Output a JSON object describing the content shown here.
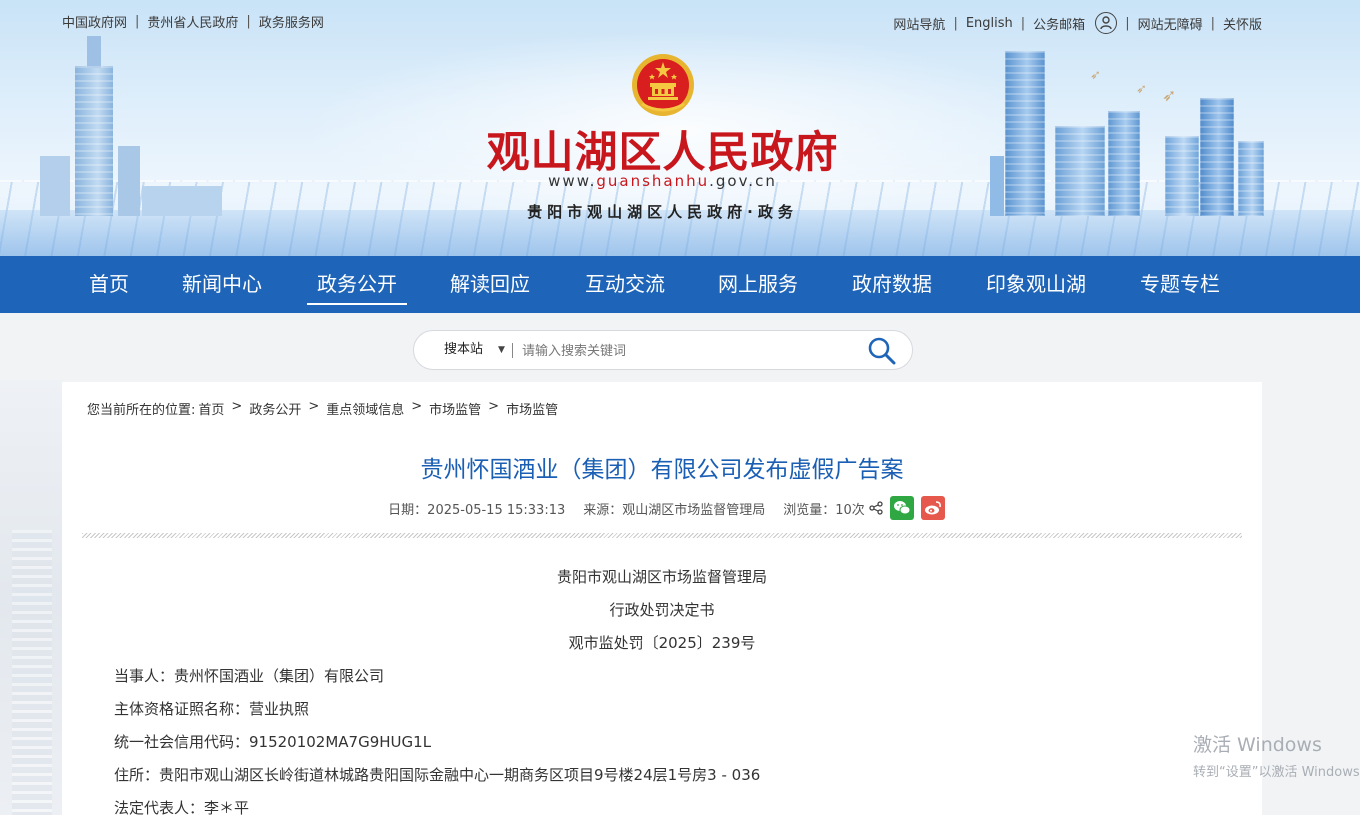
{
  "topbar": {
    "left_links": [
      "中国政府网",
      "贵州省人民政府",
      "政务服务网"
    ],
    "right_links_before_icon": [
      "网站导航",
      "English",
      "公务邮箱"
    ],
    "right_links_after_icon": [
      "网站无障碍",
      "关怀版"
    ]
  },
  "site": {
    "title": "观山湖区人民政府",
    "url_prefix": "www.",
    "url_highlight": "guanshanhu",
    "url_suffix": ".gov.cn",
    "subtitle": "贵阳市观山湖区人民政府·政务"
  },
  "nav": {
    "items": [
      "首页",
      "新闻中心",
      "政务公开",
      "解读回应",
      "互动交流",
      "网上服务",
      "政府数据",
      "印象观山湖",
      "专题专栏"
    ],
    "active": "政务公开"
  },
  "search": {
    "scope": "搜本站",
    "placeholder": "请输入搜索关键词"
  },
  "breadcrumb": {
    "prefix": "您当前所在的位置:",
    "items": [
      "首页",
      "政务公开",
      "重点领域信息",
      "市场监管",
      "市场监管"
    ],
    "separator": ">"
  },
  "article": {
    "title": "贵州怀国酒业（集团）有限公司发布虚假广告案",
    "date": "日期：2025-05-15 15:33:13",
    "source": "来源：观山湖区市场监督管理局",
    "views": "浏览量：10次",
    "center_lines": [
      "贵阳市观山湖区市场监督管理局",
      "行政处罚决定书",
      "观市监处罚〔2025〕239号"
    ],
    "body_lines": [
      "当事人：贵州怀国酒业（集团）有限公司",
      "主体资格证照名称：营业执照",
      "统一社会信用代码：91520102MA7G9HUG1L",
      "住所：贵阳市观山湖区长岭街道林城路贵阳国际金融中心一期商务区项目9号楼24层1号房3 - 036",
      "法定代表人：李＊平"
    ]
  },
  "watermark": {
    "title": "激活 Windows",
    "subtitle": "转到“设置”以激活 Windows。"
  },
  "colors": {
    "nav_bg": "#1e64b8",
    "title_red": "#c8161d",
    "article_title_blue": "#1a5fb4",
    "wechat_green": "#2fa843",
    "weibo_red": "#e5584b"
  },
  "icons": [
    "user-icon",
    "search-icon",
    "share-icon",
    "wechat-icon",
    "weibo-icon",
    "national-emblem-icon"
  ]
}
